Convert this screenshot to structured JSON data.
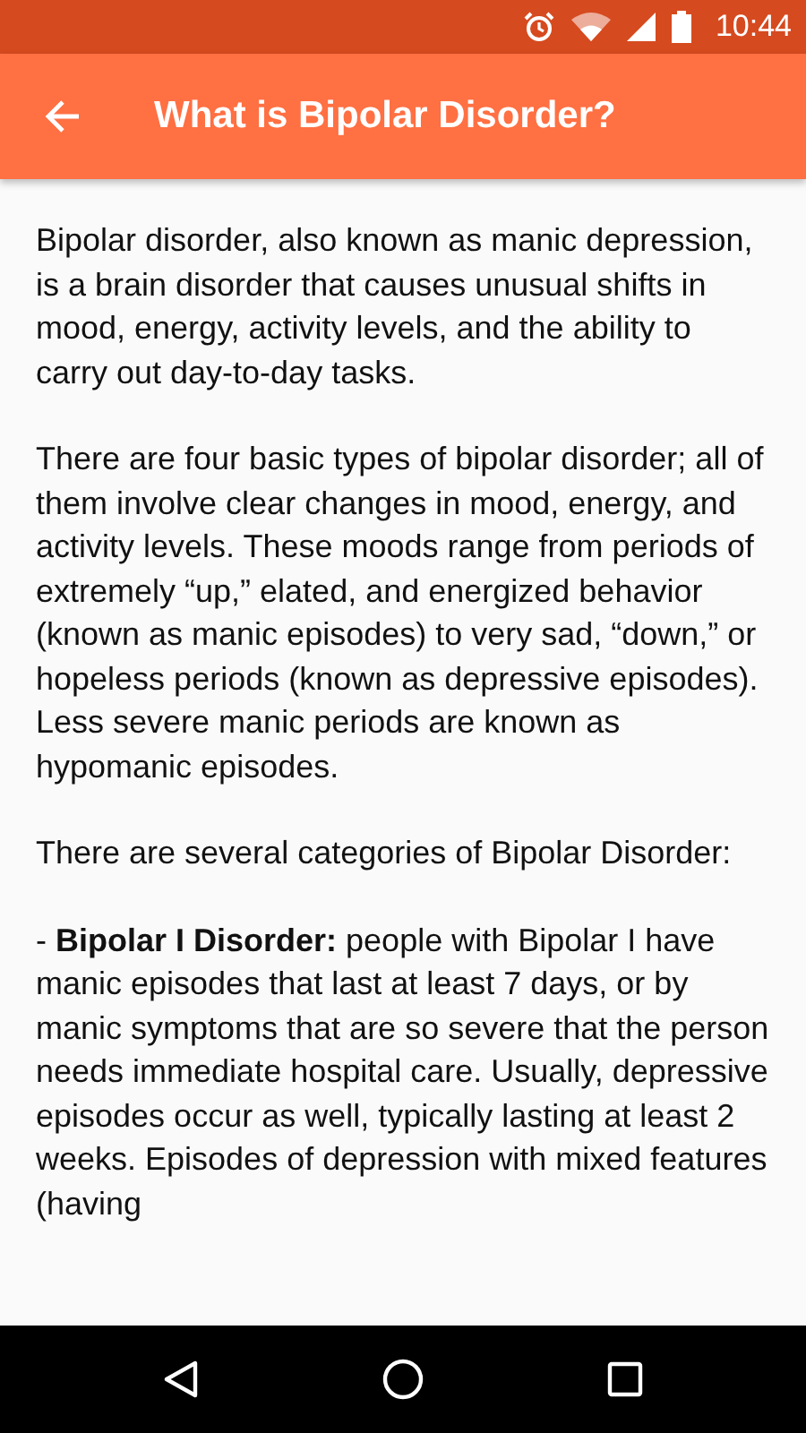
{
  "status_bar": {
    "time": "10:44"
  },
  "app_bar": {
    "title": "What is Bipolar Disorder?"
  },
  "paragraphs": [
    "Bipolar disorder, also known as manic depression, is a brain disorder that causes unusual shifts in mood, energy, activity levels, and the ability to carry out day-to-day tasks.",
    "There are four basic types of bipolar disorder; all of them involve clear changes in mood, energy, and activity levels. These moods range from periods of extremely “up,” elated, and energized behavior (known as manic episodes) to very sad, “down,” or hopeless periods (known as depressive episodes). Less severe manic periods are known as hypomanic episodes.",
    "There are several categories of Bipolar Disorder:",
    "- **Bipolar I Disorder:** people with Bipolar I have manic episodes that last at least 7 days, or by manic symptoms that are so severe that the person needs immediate hospital care. Usually, depressive episodes occur as well, typically lasting at least 2 weeks. Episodes of depression with mixed features (having"
  ]
}
